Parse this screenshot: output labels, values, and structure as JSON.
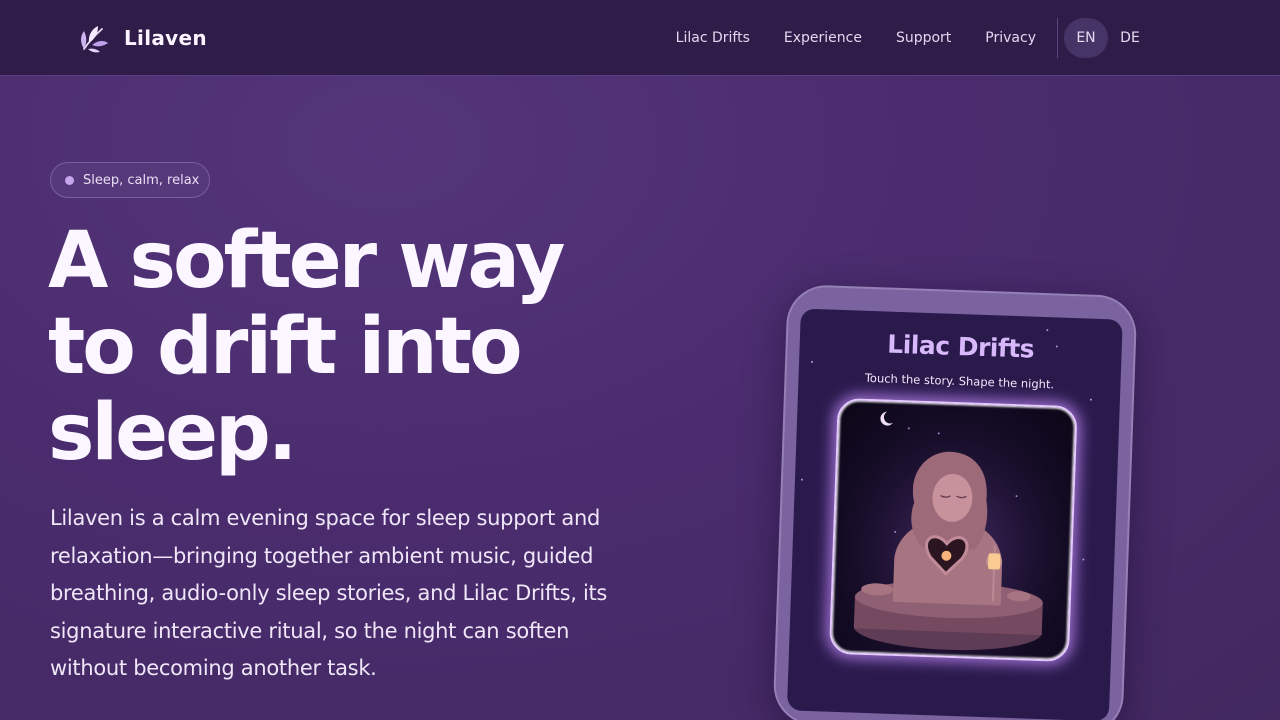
{
  "header": {
    "brand": "Lilaven",
    "logo_icon": "leaf-sprig-icon",
    "nav": [
      "Lilac Drifts",
      "Experience",
      "Support",
      "Privacy"
    ],
    "languages": [
      {
        "code": "EN",
        "active": true
      },
      {
        "code": "DE",
        "active": false
      }
    ]
  },
  "hero": {
    "badge": "Sleep, calm, relax",
    "headline_lines": [
      "A softer way",
      "to drift into",
      "sleep."
    ],
    "lede": "Lilaven is a calm evening space for sleep support and relaxation—bringing together ambient music, guided breathing, audio-only sleep stories, and Lilac Drifts, its signature interactive ritual, so the night can soften without becoming another task."
  },
  "device": {
    "title": "Lilac Drifts",
    "subtitle": "Touch the story. Shape the night.",
    "art_icon": "sleeping-woman-statue-illustration"
  },
  "colors": {
    "background": "#4a2c6e",
    "header": "#2f1c48",
    "accent": "#d7b8fb"
  }
}
